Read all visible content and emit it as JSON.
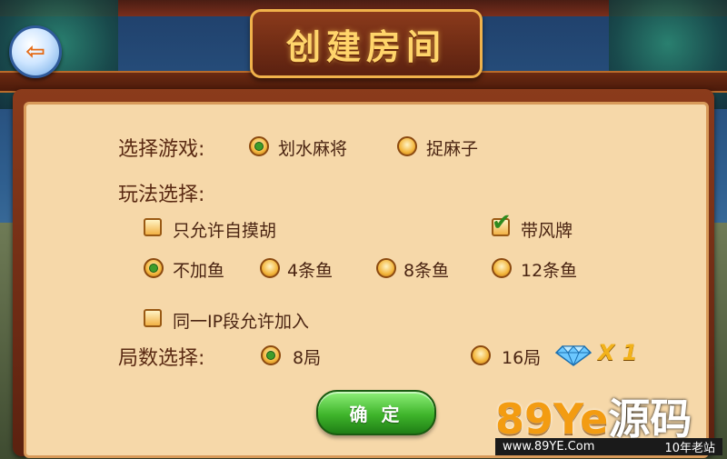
{
  "header": {
    "title": "创建房间"
  },
  "back_icon": "exit-door-icon",
  "game_select": {
    "label": "选择游戏:",
    "options": [
      {
        "label": "划水麻将",
        "checked": true
      },
      {
        "label": "捉麻子",
        "checked": false
      }
    ]
  },
  "play_mode": {
    "label": "玩法选择:",
    "checkbox_self_draw": {
      "label": "只允许自摸胡",
      "checked": false
    },
    "checkbox_wind_tiles": {
      "label": "带风牌",
      "checked": true
    },
    "fish_options": [
      {
        "label": "不加鱼",
        "checked": true
      },
      {
        "label": "4条鱼",
        "checked": false
      },
      {
        "label": "8条鱼",
        "checked": false
      },
      {
        "label": "12条鱼",
        "checked": false
      }
    ],
    "checkbox_same_ip": {
      "label": "同一IP段允许加入",
      "checked": false
    }
  },
  "rounds": {
    "label": "局数选择:",
    "options": [
      {
        "label": "8局",
        "checked": true
      },
      {
        "label": "16局",
        "checked": false
      }
    ],
    "cost_icon": "diamond-icon",
    "cost_text": "X 1"
  },
  "confirm_label": "确 定",
  "watermark": {
    "main_part1": "89Ye",
    "main_part2": "源码",
    "url": "www.89YE.Com",
    "tag": "10年老站"
  },
  "colors": {
    "panel_bg": "#f6d8a9",
    "frame": "#8b3b1b",
    "accent_gold": "#ffd56b",
    "confirm_green": "#3fb52b"
  }
}
